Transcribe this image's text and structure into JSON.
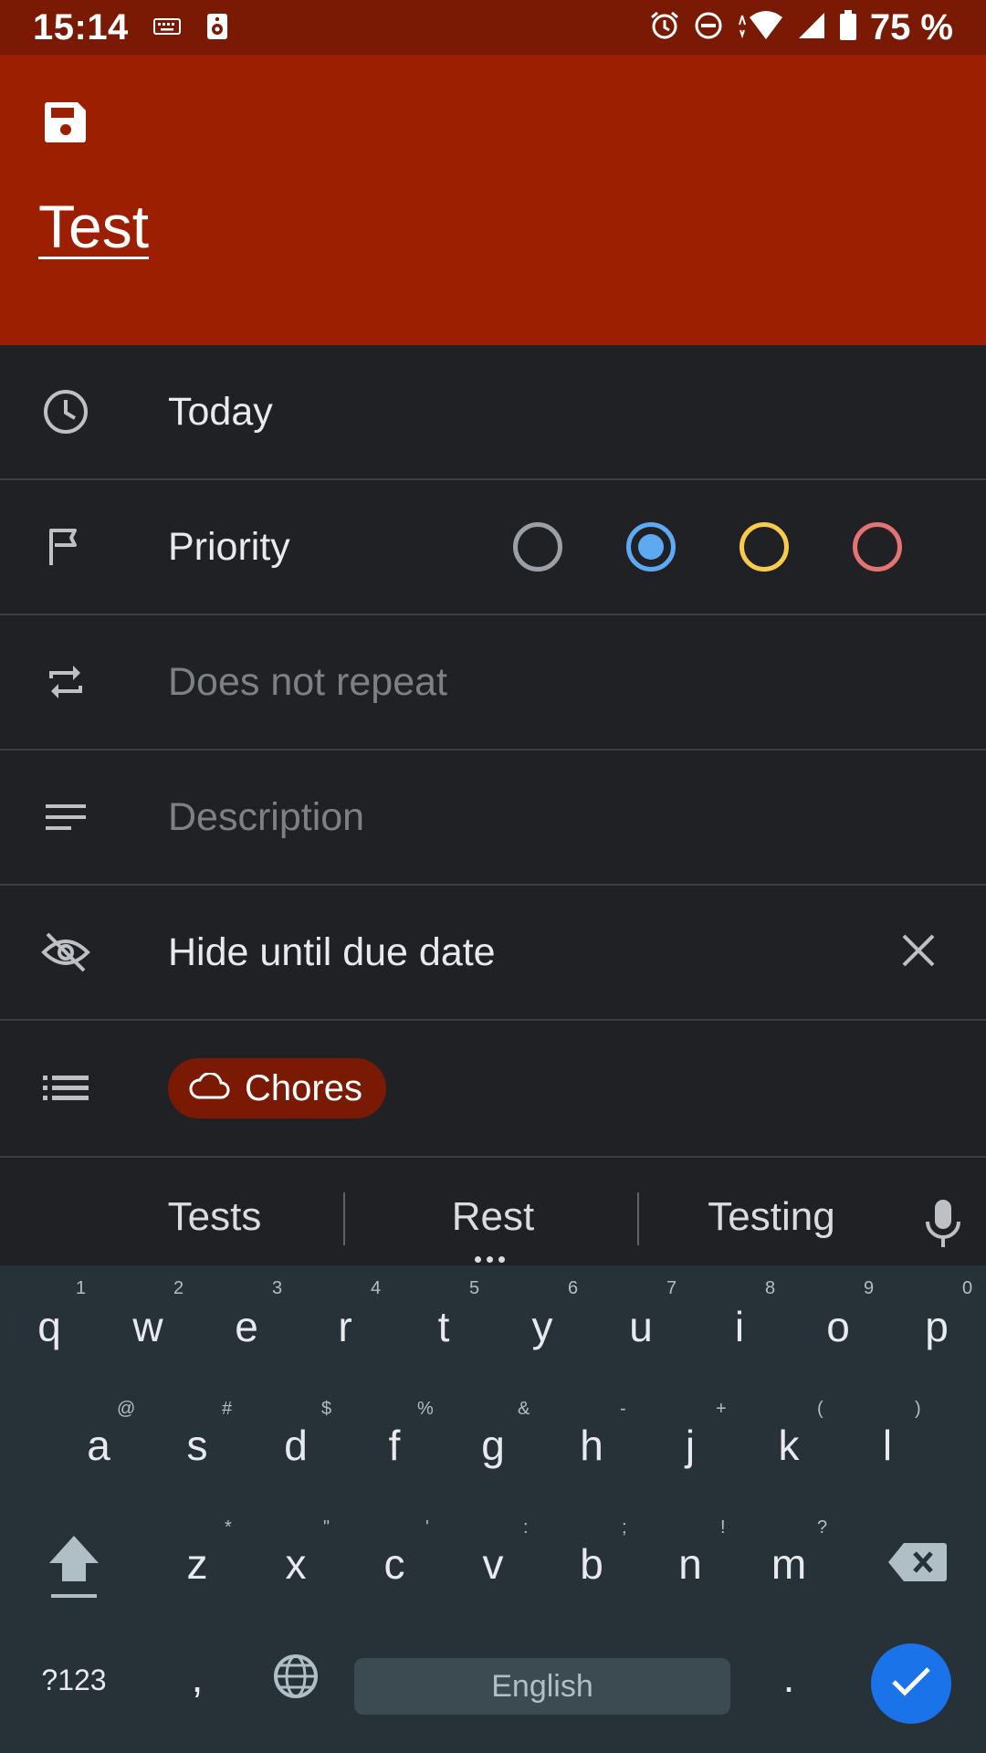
{
  "status_bar": {
    "time": "15:14",
    "battery": "75 %",
    "icons": [
      "keyboard-icon",
      "speaker-icon",
      "alarm-icon",
      "do-not-disturb-icon",
      "wifi-icon",
      "signal-icon",
      "battery-icon"
    ]
  },
  "header": {
    "title": "Test",
    "save_icon": "save-icon",
    "background": "#9b1f00"
  },
  "rows": {
    "due": {
      "icon": "clock-icon",
      "label": "Today"
    },
    "priority": {
      "icon": "flag-icon",
      "label": "Priority",
      "options": [
        {
          "color": "#9aa0a6",
          "selected": false
        },
        {
          "color": "#5eaaf2",
          "selected": true
        },
        {
          "color": "#f9cb4c",
          "selected": false
        },
        {
          "color": "#e57373",
          "selected": false
        }
      ]
    },
    "repeat": {
      "icon": "repeat-icon",
      "placeholder": "Does not repeat"
    },
    "description": {
      "icon": "description-icon",
      "placeholder": "Description"
    },
    "hide": {
      "icon": "eye-off-icon",
      "label": "Hide until due date",
      "clear_icon": "close-icon"
    },
    "list": {
      "icon": "list-icon",
      "chip_icon": "cloud-icon",
      "chip_label": "Chores"
    }
  },
  "keyboard": {
    "suggestions": [
      "Tests",
      "Rest",
      "Testing"
    ],
    "row1": [
      "q",
      "w",
      "e",
      "r",
      "t",
      "y",
      "u",
      "i",
      "o",
      "p"
    ],
    "row1_hints": [
      "1",
      "2",
      "3",
      "4",
      "5",
      "6",
      "7",
      "8",
      "9",
      "0"
    ],
    "row2": [
      "a",
      "s",
      "d",
      "f",
      "g",
      "h",
      "j",
      "k",
      "l"
    ],
    "row2_hints": [
      "@",
      "#",
      "$",
      "%",
      "&",
      "-",
      "+",
      "(",
      ")"
    ],
    "row3": [
      "z",
      "x",
      "c",
      "v",
      "b",
      "n",
      "m"
    ],
    "row3_hints": [
      "*",
      "\"",
      "'",
      ":",
      ";",
      "!",
      "?"
    ],
    "symbols_key": "?123",
    "comma": ",",
    "period": ".",
    "space_label": "English"
  }
}
